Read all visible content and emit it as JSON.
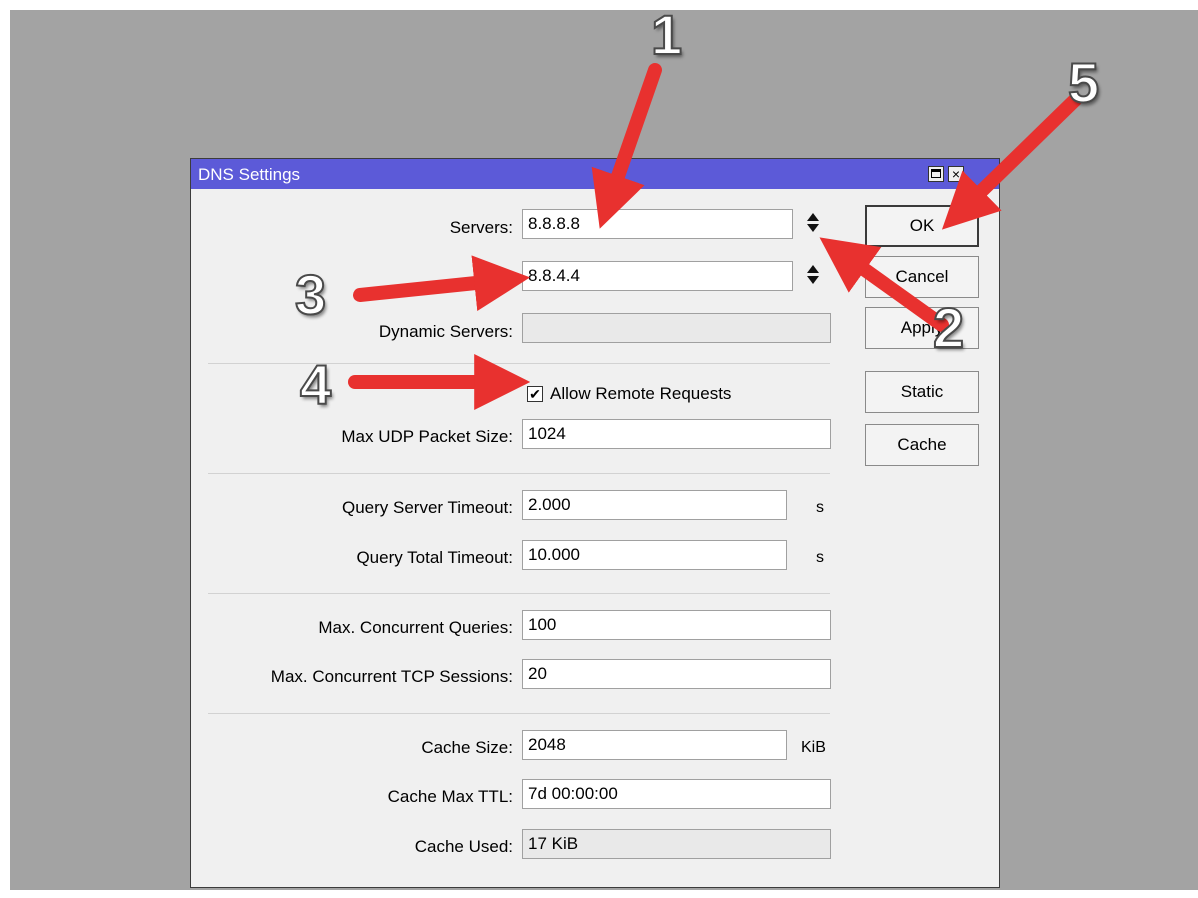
{
  "window": {
    "title": "DNS Settings",
    "close_glyph": "×"
  },
  "fields": {
    "servers_label": "Servers:",
    "server1": "8.8.8.8",
    "server2": "8.8.4.4",
    "dynamic_servers_label": "Dynamic Servers:",
    "dynamic_servers": "",
    "allow_remote_label": "Allow Remote Requests",
    "allow_remote_checked": true,
    "check_glyph": "✔",
    "max_udp_label": "Max UDP Packet Size:",
    "max_udp": "1024",
    "query_server_timeout_label": "Query Server Timeout:",
    "query_server_timeout": "2.000",
    "query_server_timeout_unit": "s",
    "query_total_timeout_label": "Query Total Timeout:",
    "query_total_timeout": "10.000",
    "query_total_timeout_unit": "s",
    "max_concurrent_queries_label": "Max. Concurrent Queries:",
    "max_concurrent_queries": "100",
    "max_concurrent_tcp_label": "Max. Concurrent TCP Sessions:",
    "max_concurrent_tcp": "20",
    "cache_size_label": "Cache Size:",
    "cache_size": "2048",
    "cache_size_unit": "KiB",
    "cache_max_ttl_label": "Cache Max TTL:",
    "cache_max_ttl": "7d 00:00:00",
    "cache_used_label": "Cache Used:",
    "cache_used": "17 KiB"
  },
  "buttons": {
    "ok": "OK",
    "cancel": "Cancel",
    "apply": "Apply",
    "static": "Static",
    "cache": "Cache"
  },
  "annotations": {
    "color": "#e8312f",
    "labels": [
      "1",
      "2",
      "3",
      "4",
      "5"
    ]
  }
}
